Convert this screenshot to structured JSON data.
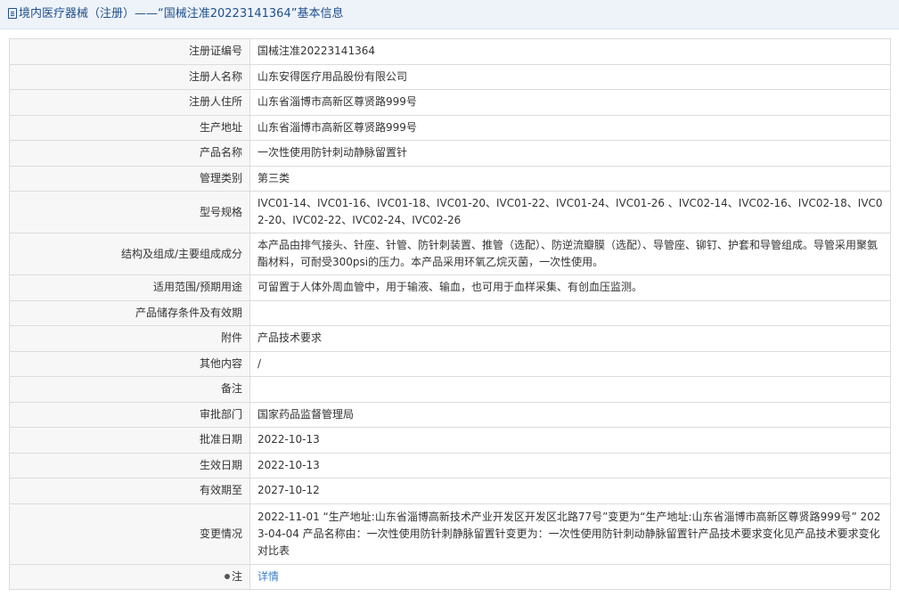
{
  "header": {
    "title": "境内医疗器械（注册）——“国械注准20223141364”基本信息"
  },
  "rows": [
    {
      "label": "注册证编号",
      "value": "国械注准20223141364"
    },
    {
      "label": "注册人名称",
      "value": "山东安得医疗用品股份有限公司"
    },
    {
      "label": "注册人住所",
      "value": "山东省淄博市高新区尊贤路999号"
    },
    {
      "label": "生产地址",
      "value": "山东省淄博市高新区尊贤路999号"
    },
    {
      "label": "产品名称",
      "value": "一次性使用防针刺动静脉留置针"
    },
    {
      "label": "管理类别",
      "value": "第三类"
    },
    {
      "label": "型号规格",
      "value": "IVC01-14、IVC01-16、IVC01-18、IVC01-20、IVC01-22、IVC01-24、IVC01-26 、IVC02-14、IVC02-16、IVC02-18、IVC02-20、IVC02-22、IVC02-24、IVC02-26"
    },
    {
      "label": "结构及组成/主要组成成分",
      "value": "本产品由排气接头、针座、针管、防针刺装置、推管（选配）、防逆流瓣膜（选配）、导管座、铆钉、护套和导管组成。导管采用聚氨酯材料，可耐受300psi的压力。本产品采用环氧乙烷灭菌，一次性使用。"
    },
    {
      "label": "适用范围/预期用途",
      "value": "可留置于人体外周血管中，用于输液、输血，也可用于血样采集、有创血压监测。"
    },
    {
      "label": "产品储存条件及有效期",
      "value": ""
    },
    {
      "label": "附件",
      "value": "产品技术要求"
    },
    {
      "label": "其他内容",
      "value": "/"
    },
    {
      "label": "备注",
      "value": ""
    },
    {
      "label": "审批部门",
      "value": "国家药品监督管理局"
    },
    {
      "label": "批准日期",
      "value": "2022-10-13"
    },
    {
      "label": "生效日期",
      "value": "2022-10-13"
    },
    {
      "label": "有效期至",
      "value": "2027-10-12"
    },
    {
      "label": "变更情况",
      "value": "2022-11-01 “生产地址:山东省淄博高新技术产业开发区开发区北路77号”变更为“生产地址:山东省淄博市高新区尊贤路999号” 2023-04-04 产品名称由：一次性使用防针刺静脉留置针变更为：一次性使用防针刺动静脉留置针产品技术要求变化见产品技术要求变化对比表"
    }
  ],
  "note_row": {
    "label": "注",
    "link_text": "详情",
    "icon": "bullet-icon"
  }
}
